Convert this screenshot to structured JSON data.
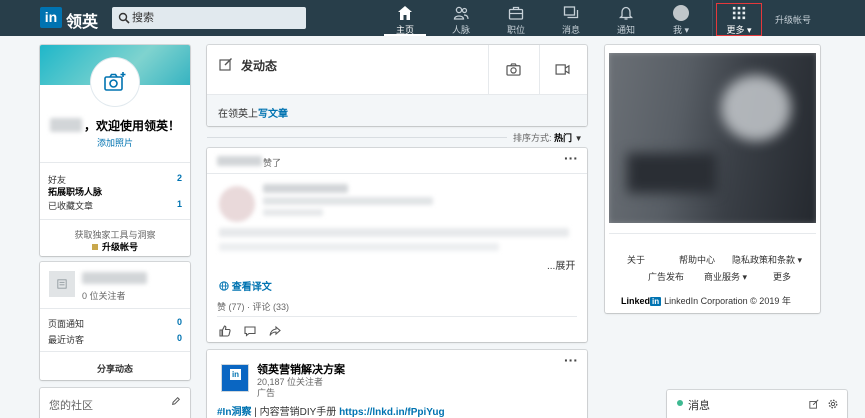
{
  "nav": {
    "logo": "in",
    "logo_text": "领英",
    "search_placeholder": "搜索",
    "items": [
      {
        "label": "主页",
        "icon": "home-icon"
      },
      {
        "label": "人脉",
        "icon": "people-icon"
      },
      {
        "label": "职位",
        "icon": "briefcase-icon"
      },
      {
        "label": "消息",
        "icon": "messaging-icon"
      },
      {
        "label": "通知",
        "icon": "bell-icon"
      },
      {
        "label": "我 ▾",
        "icon": "avatar"
      },
      {
        "label": "更多 ▾",
        "icon": "grid-icon"
      }
    ],
    "upgrade": "升级帐号"
  },
  "profile": {
    "welcome": "，欢迎使用领英！",
    "add_photo": "添加照片",
    "stats": [
      {
        "label": "好友",
        "value": "2"
      },
      {
        "label": "拓展职场人脉",
        "value": ""
      },
      {
        "label": "已收藏文章",
        "value": "1"
      }
    ],
    "premium_text": "获取独家工具与洞察",
    "premium_link": "升级帐号"
  },
  "page_card": {
    "followers": "0 位关注者",
    "stats": [
      {
        "label": "页面通知",
        "value": "0"
      },
      {
        "label": "最近访客",
        "value": "0"
      }
    ],
    "share": "分享动态"
  },
  "community": {
    "title": "您的社区"
  },
  "composer": {
    "title": "发动态",
    "article_prefix": "在领英上",
    "article_link": "写文章"
  },
  "sort": {
    "label": "排序方式:",
    "value": "热门"
  },
  "post1": {
    "liked_suffix": "赞了",
    "expand": "...展开",
    "translate": "查看译文",
    "counts": "赞 (77) · 评论 (33)"
  },
  "post2": {
    "title": "领英营销解决方案",
    "followers": "20,187 位关注者",
    "ad": "广告",
    "text_hashtag": "#In洞察",
    "text_mid": " | 内容营销DIY手册 ",
    "text_link": "https://lnkd.in/fPpiYug"
  },
  "footer": {
    "links_row1": [
      "关于",
      "帮助中心",
      "隐私政策和条款 ▾"
    ],
    "links_row2": [
      "广告发布",
      "商业服务 ▾",
      "更多"
    ],
    "brand": "Linked",
    "brand_in": "in",
    "copyright": "LinkedIn Corporation © 2019 年"
  },
  "messaging": {
    "label": "消息"
  },
  "colors": {
    "nav_bg": "#283e4a",
    "brand_blue": "#0073b1",
    "online_green": "#3eb991",
    "highlight_red": "#e5383b"
  }
}
